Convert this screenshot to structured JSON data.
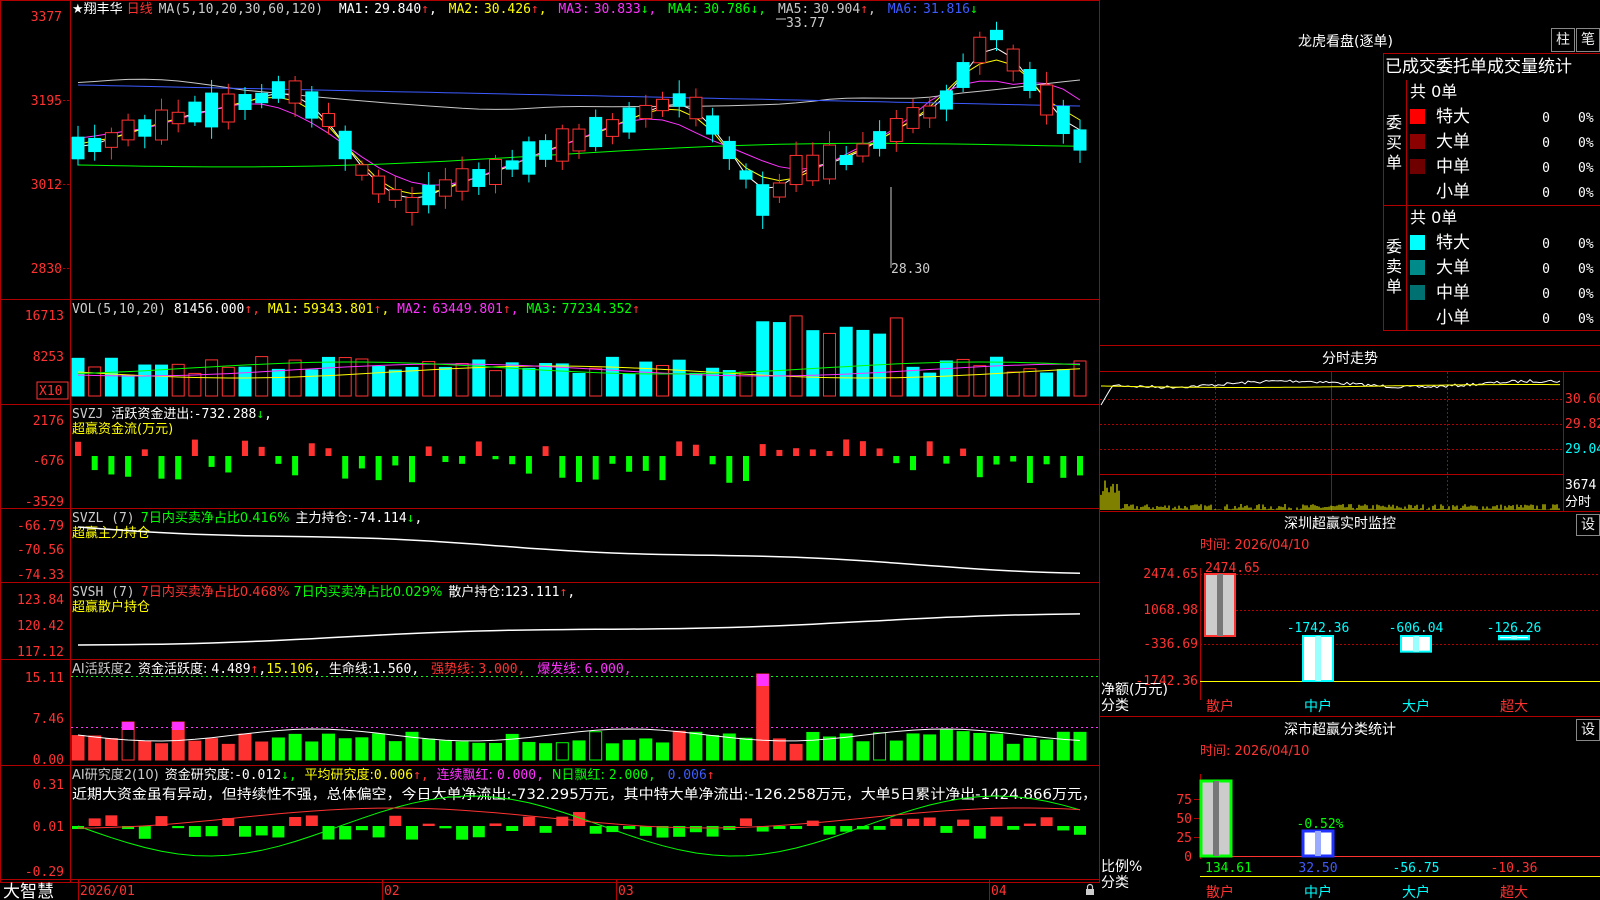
{
  "app": {
    "brand": "大智慧",
    "stock_name": "★翔丰华",
    "period": "日线",
    "ma_list": "MA(5,10,20,30,60,120)",
    "colors": {
      "up": "#ff3232",
      "down": "#00ffff",
      "green": "#00ff00",
      "grid": "#8b0000",
      "yellow": "#ffff00",
      "magenta": "#ff33ff",
      "blue": "#3d5bff",
      "white": "#ffffff"
    }
  },
  "price_panel": {
    "ma_readouts": [
      {
        "label": "MA1:",
        "value": "29.840",
        "arrow": "↑",
        "color": "#ffffff"
      },
      {
        "label": "MA2:",
        "value": "30.426",
        "arrow": "↑",
        "color": "#ffff00"
      },
      {
        "label": "MA3:",
        "value": "30.833",
        "arrow": "↓",
        "color": "#ff33ff"
      },
      {
        "label": "MA4:",
        "value": "30.786",
        "arrow": "↓",
        "color": "#00ff00"
      },
      {
        "label": "MA5:",
        "value": "30.904",
        "arrow": "↑",
        "color": "#c8c8c8"
      },
      {
        "label": "MA6:",
        "value": "31.816",
        "arrow": "↓",
        "color": "#3d5bff"
      }
    ],
    "y_ticks": [
      "3377",
      "3195",
      "3012",
      "2830"
    ],
    "high_label": "33.77",
    "low_label": "28.30"
  },
  "vol_panel": {
    "title": "VOL(5,10,20)",
    "value": "81456.000",
    "ma_readouts": [
      {
        "label": "MA1:",
        "value": "59343.801",
        "arrow": "↑",
        "color": "#ffff00"
      },
      {
        "label": "MA2:",
        "value": "63449.801",
        "arrow": "↑",
        "color": "#ff33ff"
      },
      {
        "label": "MA3:",
        "value": "77234.352",
        "arrow": "↑",
        "color": "#00ff00"
      }
    ],
    "y_ticks": [
      "16713",
      "8253"
    ],
    "unit": "X10"
  },
  "svzj_panel": {
    "title": "SVZJ",
    "desc": "活跃资金进出:",
    "value": "-732.288",
    "arrow": "↓",
    "subtitle": "超赢资金流(万元)",
    "y_ticks": [
      "2176",
      "-676",
      "-3529"
    ]
  },
  "svzl_panel": {
    "title": "SVZL (7)",
    "ratio_text": "7日内买卖净占比0.416%",
    "hold_text": "主力持仓:",
    "hold_value": "-74.114",
    "arrow": "↓",
    "subtitle": "超赢主力持仓",
    "y_ticks": [
      "-66.79",
      "-70.56",
      "-74.33"
    ]
  },
  "svsh_panel": {
    "title": "SVSH (7)",
    "ratio1_text": "7日内买卖净占比0.468%",
    "ratio2_text": "7日内买卖净占比0.029%",
    "hold_text": "散户持仓:",
    "hold_value": "123.111",
    "arrow": "↑",
    "subtitle": "超赢散户持仓",
    "y_ticks": [
      "123.84",
      "120.42",
      "117.12"
    ]
  },
  "ai_active_panel": {
    "title": "AI活跃度2",
    "desc": "资金活跃度:",
    "value": "4.489",
    "arrow1": "↑",
    "value2": "15.106",
    "life_text": "生命线:",
    "life_value": "1.560",
    "strong_text": "强势线:",
    "strong_value": "3.000",
    "burst_text": "爆发线:",
    "burst_value": "6.000",
    "y_ticks": [
      "15.11",
      "7.46",
      "0.00"
    ]
  },
  "ai_research_panel": {
    "title": "AI研究度2(10)",
    "desc": "资金研究度:",
    "value": "-0.012",
    "avg_text": "平均研究度:",
    "avg_value": "0.006",
    "red_text": "连续飘红:",
    "red_value": "0.000",
    "nday_text": "N日飘红:",
    "nday_value": "2.000",
    "last_value": "0.006",
    "commentary": "近期大资金虽有异动，但持续性不强，总体偏空，今日大单净流出:-732.295万元，其中特大单净流出:-126.258万元，大单5日累计净出-1424.866万元，",
    "y_ticks": [
      "0.31",
      "0.01",
      "-0.29"
    ]
  },
  "date_axis": [
    "2026/01",
    "02",
    "03",
    "04"
  ],
  "right_panel": {
    "dragon_title": "龙虎看盘(逐单)",
    "btn_column": "柱",
    "btn_stroke": "笔",
    "header": "已成交委托单成交量统计",
    "buy": {
      "side_label": "委买单",
      "total": "共 0单",
      "rows": [
        {
          "name": "特大",
          "count": "0",
          "pct": "0%",
          "color": "#ff0000"
        },
        {
          "name": "大单",
          "count": "0",
          "pct": "0%",
          "color": "#8b0000"
        },
        {
          "name": "中单",
          "count": "0",
          "pct": "0%",
          "color": "#6e0000"
        },
        {
          "name": "小单",
          "count": "0",
          "pct": "0%",
          "color": ""
        }
      ]
    },
    "sell": {
      "side_label": "委卖单",
      "total": "共 0单",
      "rows": [
        {
          "name": "特大",
          "count": "0",
          "pct": "0%",
          "color": "#00ffff"
        },
        {
          "name": "大单",
          "count": "0",
          "pct": "0%",
          "color": "#008b8b"
        },
        {
          "name": "中单",
          "count": "0",
          "pct": "0%",
          "color": "#007070"
        },
        {
          "name": "小单",
          "count": "0",
          "pct": "0%",
          "color": ""
        }
      ]
    },
    "intraday": {
      "title": "分时走势",
      "y_ticks": [
        "30.60",
        "29.82",
        "29.04"
      ],
      "vol_tick": "3674",
      "vol_label": "分时"
    },
    "sz_monitor": {
      "title": "深圳超赢实时监控",
      "time": "时间: 2026/04/10",
      "setting": "设",
      "ylabel_line1": "净额(万元)",
      "ylabel_line2": "分类",
      "y_ticks": [
        "2474.65",
        "1068.98",
        "-336.69",
        "-1742.36"
      ]
    },
    "sz_classify": {
      "title": "深市超赢分类统计",
      "time": "时间: 2026/04/10",
      "setting": "设",
      "ylabel_line1": "比例%",
      "ylabel_line2": "分类",
      "y_ticks": [
        "75",
        "50",
        "25",
        "0"
      ]
    }
  },
  "chart_data": [
    {
      "type": "bar",
      "title": "深圳超赢实时监控",
      "categories": [
        "散户",
        "中户",
        "大户",
        "超大"
      ],
      "values": [
        2474.65,
        -1742.36,
        -606.04,
        -126.26
      ],
      "ylim": [
        -1742.36,
        2474.65
      ]
    },
    {
      "type": "bar",
      "title": "深市超赢分类统计",
      "categories": [
        "散户",
        "中户",
        "大户",
        "超大"
      ],
      "values": [
        134.61,
        32.5,
        -56.75,
        -10.36
      ],
      "annotation": "-0.52%",
      "ylim": [
        0,
        75
      ]
    }
  ]
}
